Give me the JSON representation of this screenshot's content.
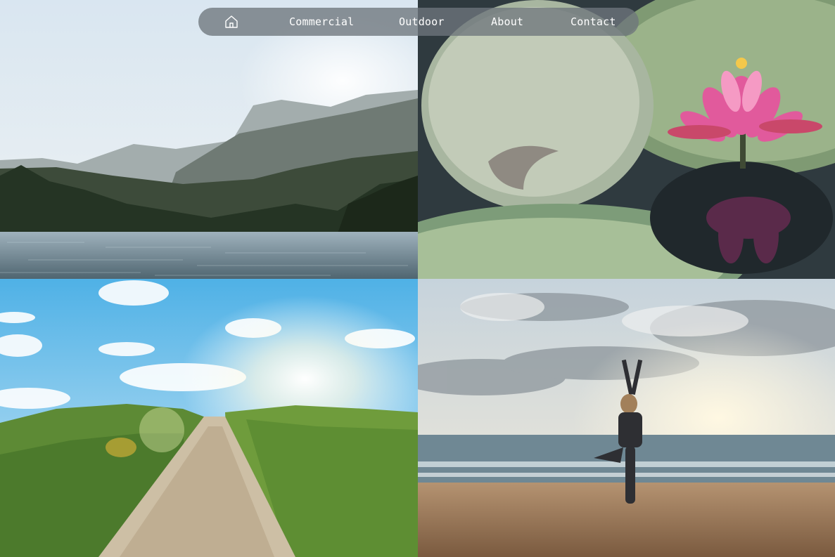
{
  "nav": {
    "home_icon": "home-icon",
    "items": [
      {
        "label": "Commercial"
      },
      {
        "label": "Outdoor"
      },
      {
        "label": "About"
      },
      {
        "label": "Contact"
      }
    ]
  },
  "gallery": {
    "photos": [
      {
        "subject": "mountain-lake"
      },
      {
        "subject": "pink-water-lily"
      },
      {
        "subject": "sunny-grass-path"
      },
      {
        "subject": "beach-yoga-sunset"
      }
    ]
  },
  "colors": {
    "nav_bg": "#6e767c",
    "nav_text": "#ffffff"
  }
}
